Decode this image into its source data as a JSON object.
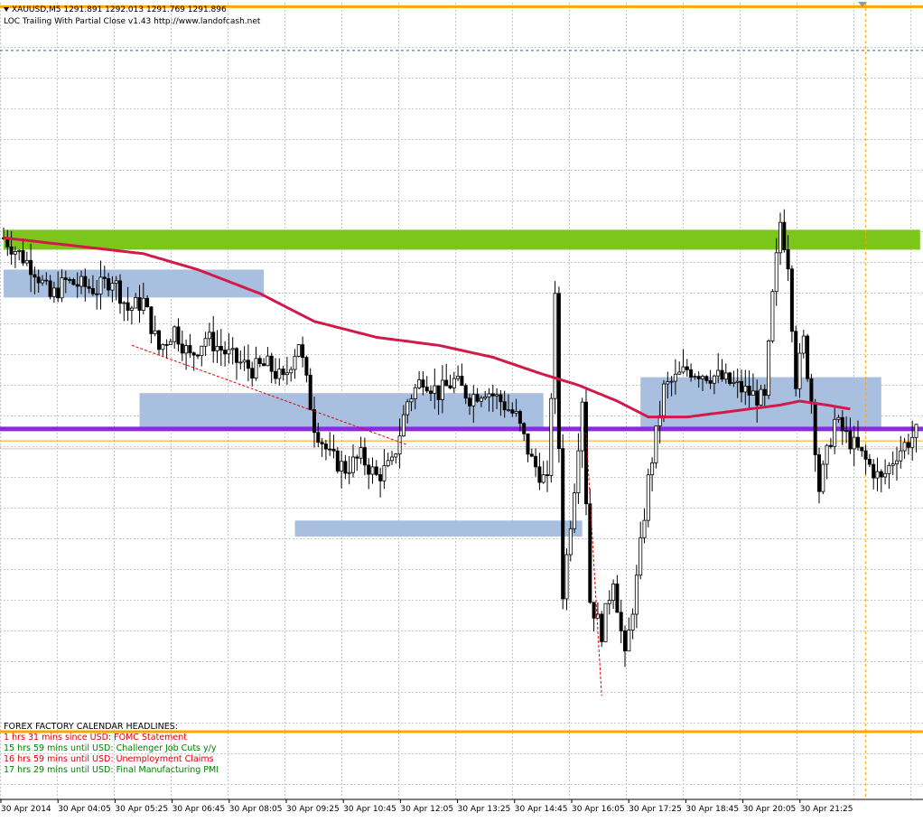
{
  "header": {
    "symbol_line": "XAUUSD,M5  1291.891 1292.013 1291.769 1291.896",
    "ea_line": "LOC Trailing With Partial Close v1.43 http://www.landofcash.net"
  },
  "news": {
    "title": "FOREX FACTORY CALENDAR HEADLINES:",
    "items": [
      {
        "text": "1 hrs 31 mins since USD: FOMC Statement",
        "color": "#e00000"
      },
      {
        "text": "15 hrs 59 mins until USD: Challenger Job Cuts y/y",
        "color": "#008000"
      },
      {
        "text": "16 hrs 59 mins until USD: Unemployment Claims",
        "color": "#e00000"
      },
      {
        "text": "17 hrs 29 mins until USD: Final Manufacturing PMI",
        "color": "#008000"
      }
    ]
  },
  "colors": {
    "bull_body": "#ffffff",
    "bear_body": "#000000",
    "ma": "#d11a4a",
    "support": "#8a2be2",
    "orange": "#ffa500",
    "green_zone": "#7cc61c",
    "blue_zone": "#a9bfdf",
    "grid": "#c8c8c8"
  },
  "chart_data": {
    "type": "candlestick",
    "y_range": [
      1282.0,
      1302.0
    ],
    "x_tick_labels": [
      "30 Apr 2014",
      "30 Apr 04:05",
      "30 Apr 05:25",
      "30 Apr 06:45",
      "30 Apr 08:05",
      "30 Apr 09:25",
      "30 Apr 10:45",
      "30 Apr 12:05",
      "30 Apr 13:25",
      "30 Apr 14:45",
      "30 Apr 16:05",
      "30 Apr 17:25",
      "30 Apr 18:45",
      "30 Apr 20:05",
      "30 Apr 21:25"
    ],
    "candle_count": 236,
    "close_path": [
      [
        0,
        1296.1
      ],
      [
        8,
        1295.3
      ],
      [
        12,
        1294.6
      ],
      [
        16,
        1295.0
      ],
      [
        24,
        1294.8
      ],
      [
        28,
        1295.1
      ],
      [
        32,
        1294.3
      ],
      [
        36,
        1294.5
      ],
      [
        40,
        1293.3
      ],
      [
        44,
        1293.8
      ],
      [
        48,
        1293.1
      ],
      [
        52,
        1293.6
      ],
      [
        56,
        1293.3
      ],
      [
        60,
        1293.0
      ],
      [
        64,
        1292.8
      ],
      [
        68,
        1292.9
      ],
      [
        72,
        1292.5
      ],
      [
        76,
        1293.5
      ],
      [
        80,
        1291.4
      ],
      [
        84,
        1290.6
      ],
      [
        88,
        1290.3
      ],
      [
        92,
        1290.6
      ],
      [
        96,
        1290.1
      ],
      [
        100,
        1290.4
      ],
      [
        104,
        1292.0
      ],
      [
        108,
        1292.6
      ],
      [
        112,
        1292.2
      ],
      [
        116,
        1292.5
      ],
      [
        120,
        1292.1
      ],
      [
        124,
        1292.3
      ],
      [
        128,
        1292.0
      ],
      [
        132,
        1291.6
      ],
      [
        136,
        1290.5
      ],
      [
        140,
        1289.9
      ],
      [
        142,
        1294.5
      ],
      [
        144,
        1287.2
      ],
      [
        147,
        1289.9
      ],
      [
        149,
        1292.1
      ],
      [
        151,
        1287.0
      ],
      [
        154,
        1286.2
      ],
      [
        157,
        1287.6
      ],
      [
        160,
        1285.5
      ],
      [
        163,
        1287.5
      ],
      [
        166,
        1290.0
      ],
      [
        170,
        1292.3
      ],
      [
        176,
        1292.8
      ],
      [
        184,
        1292.6
      ],
      [
        190,
        1292.3
      ],
      [
        196,
        1292.0
      ],
      [
        198,
        1294.6
      ],
      [
        200,
        1296.5
      ],
      [
        202,
        1295.5
      ],
      [
        204,
        1292.5
      ],
      [
        206,
        1293.5
      ],
      [
        208,
        1292.0
      ],
      [
        210,
        1289.8
      ],
      [
        214,
        1291.5
      ],
      [
        218,
        1291.0
      ],
      [
        222,
        1290.5
      ],
      [
        226,
        1290.0
      ],
      [
        230,
        1290.7
      ],
      [
        235,
        1291.2
      ]
    ],
    "ma_path": [
      [
        0,
        1296.1
      ],
      [
        18,
        1295.9
      ],
      [
        36,
        1295.7
      ],
      [
        50,
        1295.3
      ],
      [
        66,
        1294.7
      ],
      [
        80,
        1294.0
      ],
      [
        96,
        1293.6
      ],
      [
        112,
        1293.4
      ],
      [
        126,
        1293.1
      ],
      [
        138,
        1292.7
      ],
      [
        148,
        1292.4
      ],
      [
        158,
        1292.0
      ],
      [
        166,
        1291.6
      ],
      [
        170,
        1291.6
      ],
      [
        176,
        1291.6
      ],
      [
        184,
        1291.7
      ],
      [
        192,
        1291.8
      ],
      [
        200,
        1291.9
      ],
      [
        205,
        1292.0
      ],
      [
        212,
        1291.9
      ],
      [
        218,
        1291.8
      ]
    ],
    "h_lines": [
      {
        "price": 1291.3,
        "color": "support",
        "width": 5
      },
      {
        "price": 1283.7,
        "color": "orange",
        "width": 3
      },
      {
        "price": 1301.9,
        "color": "orange",
        "width": 3
      },
      {
        "price": 1291.0,
        "color": "orange",
        "width": 1
      },
      {
        "price": 1290.8,
        "color": "grid",
        "width": 1
      }
    ],
    "zones": [
      {
        "from": 0,
        "to": 67,
        "top": 1295.3,
        "bottom": 1294.6,
        "color": "blue_zone"
      },
      {
        "from": 35,
        "to": 139,
        "top": 1292.2,
        "bottom": 1291.3,
        "color": "blue_zone"
      },
      {
        "from": 75,
        "to": 149,
        "top": 1289.0,
        "bottom": 1288.6,
        "color": "blue_zone"
      },
      {
        "from": 164,
        "to": 226,
        "top": 1292.6,
        "bottom": 1291.3,
        "color": "blue_zone"
      },
      {
        "from": 0,
        "to": 236,
        "top": 1296.3,
        "bottom": 1295.8,
        "color": "green_zone"
      }
    ],
    "v_line_index": 222,
    "dashed_top_price": 1300.8,
    "trades": [
      {
        "from": 33,
        "from_price": 1293.4,
        "to": 104,
        "to_price": 1290.9
      },
      {
        "from": 150,
        "from_price": 1291.2,
        "to": 154,
        "to_price": 1284.6
      }
    ]
  }
}
